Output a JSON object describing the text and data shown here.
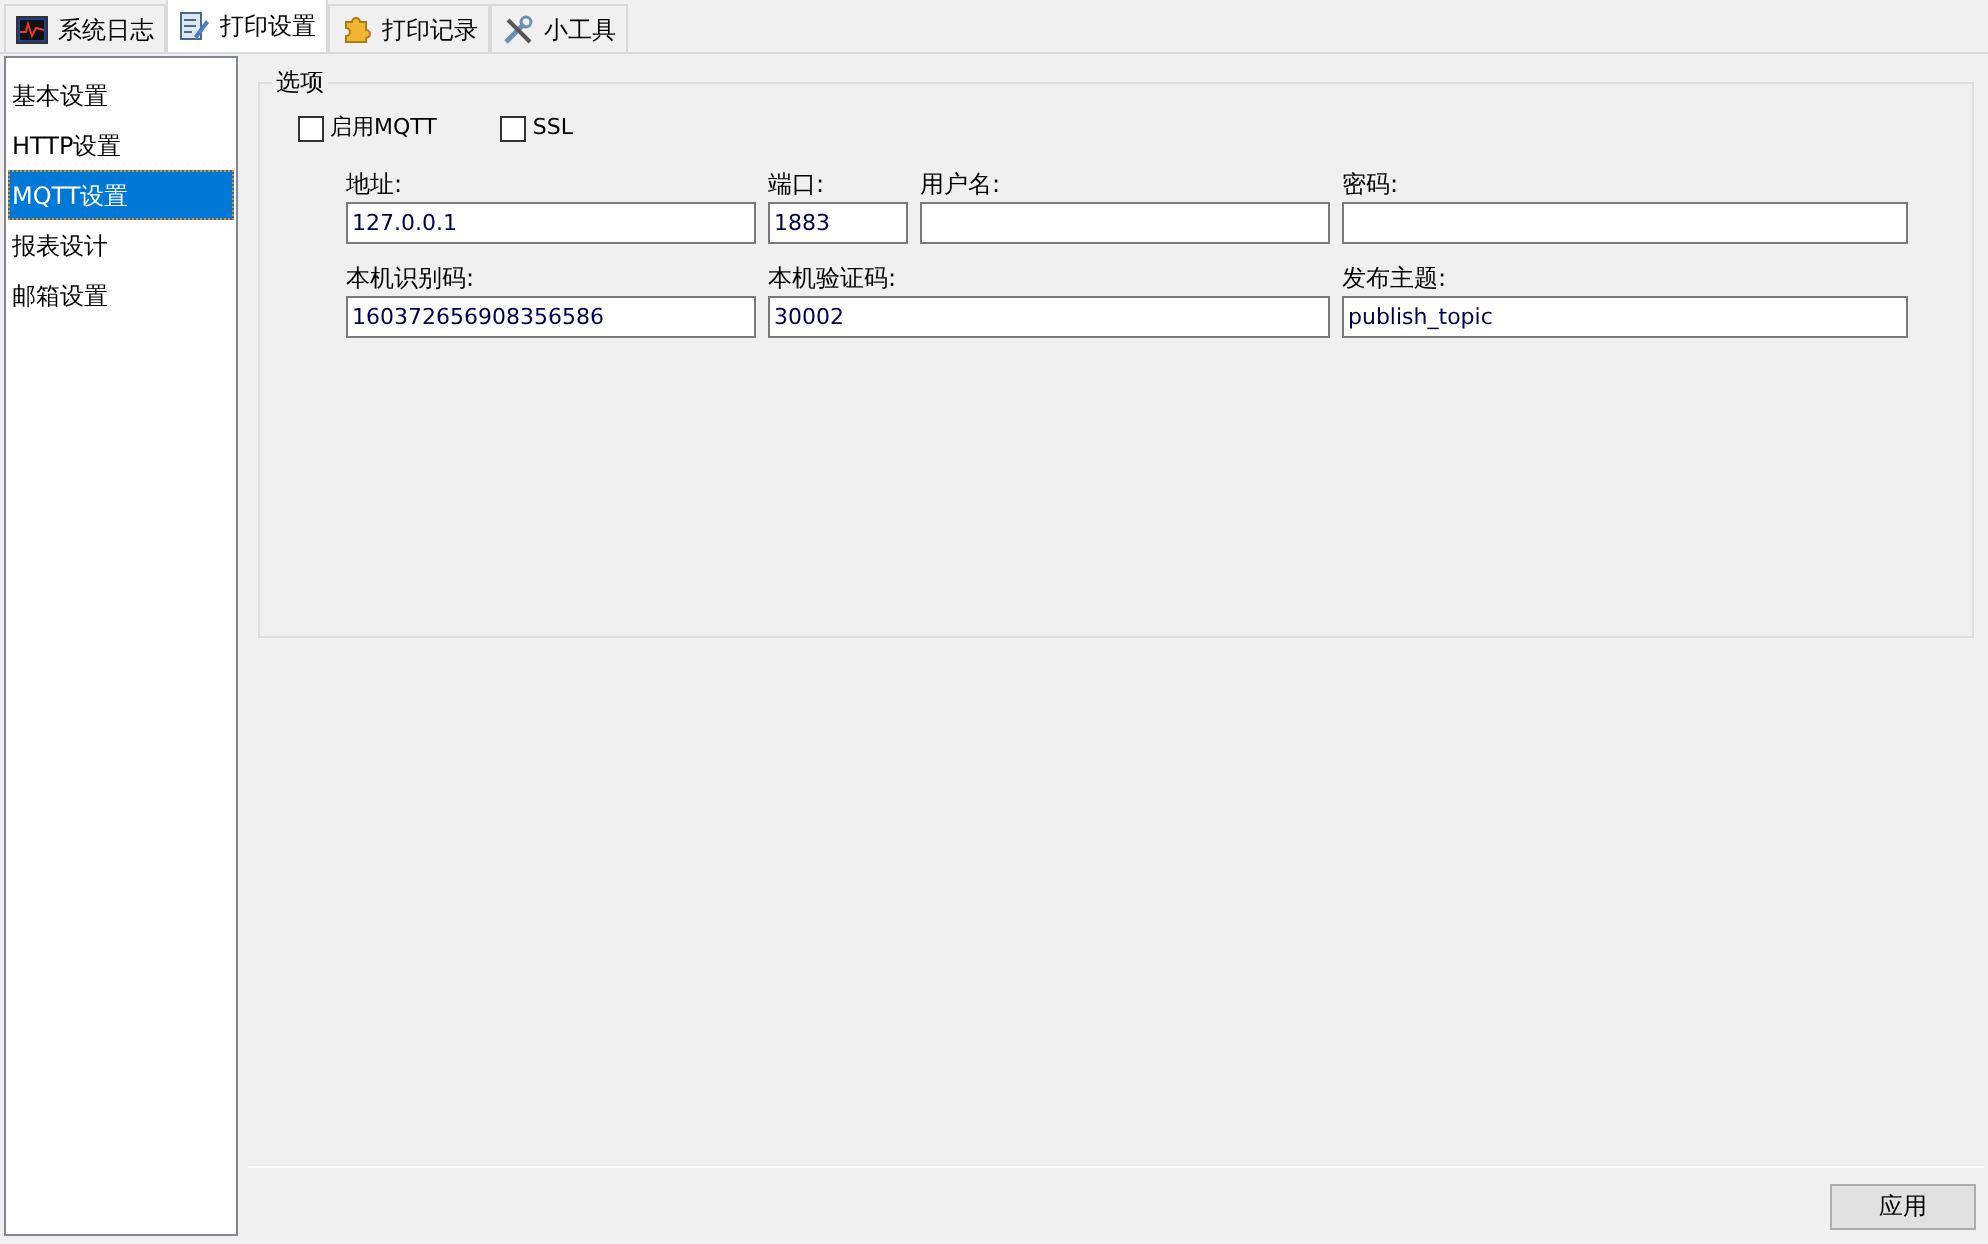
{
  "tabs": [
    {
      "label": "系统日志",
      "selected": false
    },
    {
      "label": "打印设置",
      "selected": true
    },
    {
      "label": "打印记录",
      "selected": false
    },
    {
      "label": "小工具",
      "selected": false
    }
  ],
  "sidebar": {
    "items": [
      {
        "label": "基本设置",
        "selected": false
      },
      {
        "label": "HTTP设置",
        "selected": false
      },
      {
        "label": "MQTT设置",
        "selected": true
      },
      {
        "label": "报表设计",
        "selected": false
      },
      {
        "label": "邮箱设置",
        "selected": false
      }
    ]
  },
  "options_group": {
    "title": "选项",
    "checkboxes": [
      {
        "label": "启用MQTT",
        "checked": false
      },
      {
        "label": "SSL",
        "checked": false
      }
    ],
    "field_rows": [
      [
        {
          "label": "地址:",
          "value": "127.0.0.1"
        },
        {
          "label": "端口:",
          "value": "1883"
        },
        {
          "label": "用户名:"
        },
        {
          "label": "密码:"
        }
      ],
      [
        {
          "label": "本机识别码:",
          "value": "160372656908356586"
        },
        {
          "label": "本机验证码:",
          "value": "30002"
        },
        {
          "label": "发布主题:",
          "value": "publish_topic"
        }
      ]
    ]
  },
  "apply_button": "应用"
}
